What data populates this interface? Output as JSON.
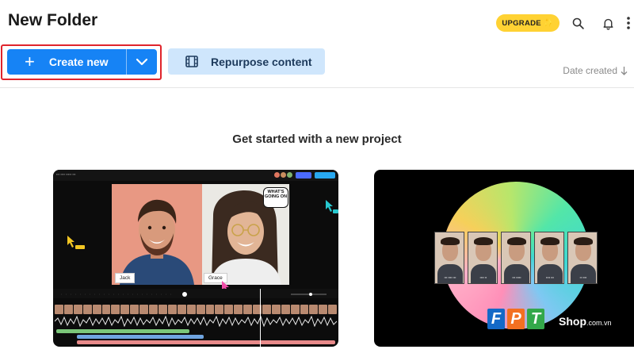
{
  "header": {
    "title": "New Folder",
    "upgrade_label": "UPGRADE",
    "upgrade_color": "#ffd233",
    "icons": [
      "search-icon",
      "bell-icon",
      "more-icon"
    ]
  },
  "toolbar": {
    "create_label": "Create new",
    "create_color": "#1683f5",
    "repurpose_label": "Repurpose content",
    "repurpose_color": "#cfe6fc"
  },
  "sort": {
    "label": "Date created"
  },
  "main": {
    "headline": "Get started with a new project",
    "card_left": {
      "name_left": "Jack",
      "name_right": "Grace",
      "speech_bubble": "WHAT'S GOING ON"
    }
  },
  "watermark": {
    "letters": [
      "F",
      "P",
      "T"
    ],
    "shop": "Shop",
    "domain": ".com.vn"
  }
}
